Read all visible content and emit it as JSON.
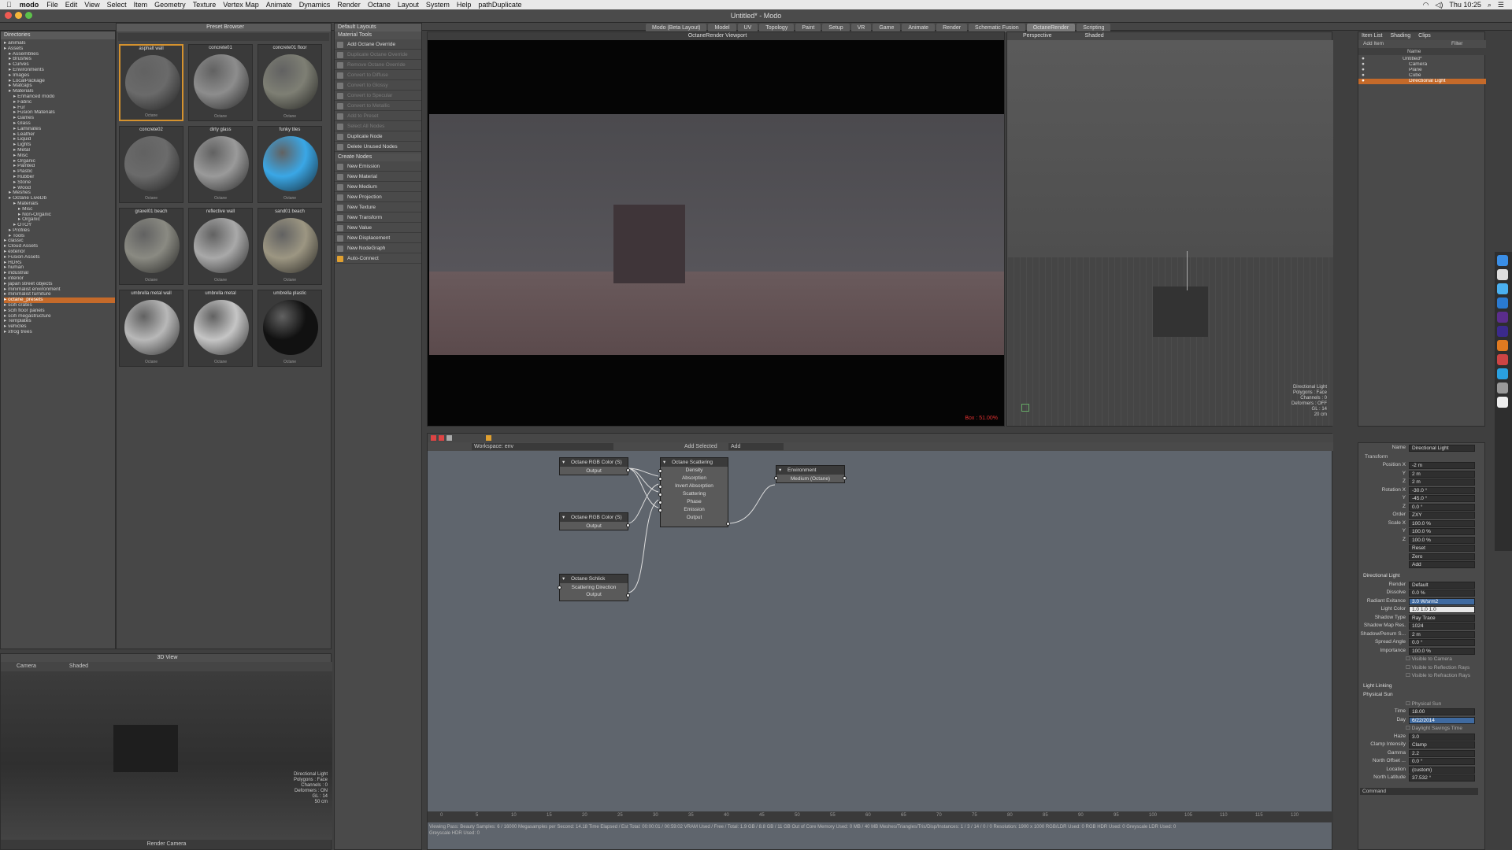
{
  "menubar": {
    "app_name": "modo",
    "items": [
      "File",
      "Edit",
      "View",
      "Select",
      "Item",
      "Geometry",
      "Texture",
      "Vertex Map",
      "Animate",
      "Dynamics",
      "Render",
      "Octane",
      "Layout",
      "System",
      "Help",
      "pathDuplicate"
    ],
    "clock": "Thu 10:25"
  },
  "window": {
    "title": "Untitled* - Modo",
    "layout_tabs": [
      "Modo (Beta Layout)",
      "Model",
      "UV",
      "Topology",
      "Paint",
      "Setup",
      "VR",
      "Game",
      "Animate",
      "Render",
      "Schematic Fusion",
      "OctaneRender",
      "Scripting"
    ],
    "active_tab": "OctaneRender"
  },
  "preset_browser": {
    "title": "Preset Browser",
    "tree_header": "Directories",
    "tree": [
      {
        "label": "animals",
        "indent": 0
      },
      {
        "label": "Assets",
        "indent": 0
      },
      {
        "label": "Assemblies",
        "indent": 1
      },
      {
        "label": "Brushes",
        "indent": 1
      },
      {
        "label": "Curves",
        "indent": 1
      },
      {
        "label": "Environments",
        "indent": 1
      },
      {
        "label": "Images",
        "indent": 1
      },
      {
        "label": "LocalPackage",
        "indent": 1
      },
      {
        "label": "Matcaps",
        "indent": 1
      },
      {
        "label": "Materials",
        "indent": 1
      },
      {
        "label": "Enhanced modo",
        "indent": 2
      },
      {
        "label": "Fabric",
        "indent": 2
      },
      {
        "label": "Fur",
        "indent": 2
      },
      {
        "label": "Fusion Materials",
        "indent": 2
      },
      {
        "label": "Games",
        "indent": 2
      },
      {
        "label": "Glass",
        "indent": 2
      },
      {
        "label": "Laminates",
        "indent": 2
      },
      {
        "label": "Leather",
        "indent": 2
      },
      {
        "label": "Liquid",
        "indent": 2
      },
      {
        "label": "Lights",
        "indent": 2
      },
      {
        "label": "Metal",
        "indent": 2
      },
      {
        "label": "Misc",
        "indent": 2
      },
      {
        "label": "Organic",
        "indent": 2
      },
      {
        "label": "Painted",
        "indent": 2
      },
      {
        "label": "Plastic",
        "indent": 2
      },
      {
        "label": "Rubber",
        "indent": 2
      },
      {
        "label": "Stone",
        "indent": 2
      },
      {
        "label": "Wood",
        "indent": 2
      },
      {
        "label": "Meshes",
        "indent": 1
      },
      {
        "label": "Octane LiveDb",
        "indent": 1
      },
      {
        "label": "Materials",
        "indent": 2
      },
      {
        "label": "Misc",
        "indent": 3
      },
      {
        "label": "Non-Organic",
        "indent": 3
      },
      {
        "label": "Organic",
        "indent": 3
      },
      {
        "label": "OTOY",
        "indent": 2
      },
      {
        "label": "Profiles",
        "indent": 1
      },
      {
        "label": "Tools",
        "indent": 1
      },
      {
        "label": "classic",
        "indent": 0
      },
      {
        "label": "Cloud Assets",
        "indent": 0
      },
      {
        "label": "exterior",
        "indent": 0
      },
      {
        "label": "Fusion Assets",
        "indent": 0
      },
      {
        "label": "HDRs",
        "indent": 0
      },
      {
        "label": "human",
        "indent": 0
      },
      {
        "label": "industrial",
        "indent": 0
      },
      {
        "label": "interior",
        "indent": 0
      },
      {
        "label": "japan street objects",
        "indent": 0
      },
      {
        "label": "minimalist environment",
        "indent": 0
      },
      {
        "label": "minimalist furniture",
        "indent": 0
      },
      {
        "label": "octane_presets",
        "indent": 0,
        "selected": true
      },
      {
        "label": "scifi crates",
        "indent": 0
      },
      {
        "label": "scifi floor panels",
        "indent": 0
      },
      {
        "label": "scifi megastructure",
        "indent": 0
      },
      {
        "label": "Templates",
        "indent": 0
      },
      {
        "label": "vehicles",
        "indent": 0
      },
      {
        "label": "xfrog trees",
        "indent": 0
      }
    ],
    "materials": [
      {
        "name": "asphalt wall",
        "color": "#6a6a6a",
        "selected": true
      },
      {
        "name": "concrete01",
        "color": "#8d8d8d"
      },
      {
        "name": "concrete01 floor",
        "color": "#7e7f74"
      },
      {
        "name": "concrete02",
        "color": "#6b6b6b"
      },
      {
        "name": "dirty glass",
        "color": "#9a9a9a"
      },
      {
        "name": "funky tiles",
        "color": "#3aa7e6"
      },
      {
        "name": "gravel01 beach",
        "color": "#8a8a82"
      },
      {
        "name": "reflective wall",
        "color": "#a9a9a9"
      },
      {
        "name": "sand01 beach",
        "color": "#9c9682"
      },
      {
        "name": "umbrella metal wall",
        "color": "#b8b8b8"
      },
      {
        "name": "umbrella metal",
        "color": "#c5c5c5"
      },
      {
        "name": "umbrella plastic",
        "color": "#111111"
      }
    ],
    "material_sub": "Octane"
  },
  "tools_panel": {
    "header": "Material Tools",
    "layout_dropdown": "Default Layouts",
    "items": [
      {
        "label": "Add Octane Override",
        "dim": false
      },
      {
        "label": "Duplicate Octane Override",
        "dim": true
      },
      {
        "label": "Remove Octane Override",
        "dim": true
      },
      {
        "label": "Convert to Diffuse",
        "dim": true
      },
      {
        "label": "Convert to Glossy",
        "dim": true
      },
      {
        "label": "Convert to Specular",
        "dim": true
      },
      {
        "label": "Convert to Metallic",
        "dim": true
      },
      {
        "label": "Add to Preset",
        "dim": true
      },
      {
        "label": "Select All Nodes",
        "dim": true
      },
      {
        "label": "Duplicate Node",
        "dim": false
      },
      {
        "label": "Delete Unused Nodes",
        "dim": false
      }
    ],
    "create_header": "Create Nodes",
    "create_items": [
      "New Emission",
      "New Material",
      "New Medium",
      "New Projection",
      "New Texture",
      "New Transform",
      "New Value",
      "New Displacement",
      "New NodeGraph"
    ],
    "auto_connect": "Auto-Connect"
  },
  "render_view": {
    "header": "OctaneRender Viewport",
    "status": "Box : 51.00%"
  },
  "viewport3d": {
    "label": "Perspective",
    "shading": "Shaded",
    "info": [
      "Directional Light",
      "Polygons : Face",
      "Channels : 0",
      "Deformers : OFF",
      "GL : 14",
      "20 cm"
    ]
  },
  "small_view": {
    "header": "3D View",
    "label": "Camera",
    "shading": "Shaded",
    "info": [
      "Directional Light",
      "Polygons : Face",
      "Channels : 0",
      "Deformers : ON",
      "GL : 14",
      "50 cm"
    ],
    "footer": "Render Camera"
  },
  "node_editor": {
    "schematic": "Workspace: env",
    "add_selected": "Add Selected",
    "add": "Add",
    "nodes": {
      "rgb1": {
        "title": "Octane RGB Color (S)",
        "out": "Output"
      },
      "rgb2": {
        "title": "Octane RGB Color (S)",
        "out": "Output"
      },
      "schlick": {
        "title": "Octane Schlick",
        "in": "Scattering Direction",
        "out": "Output"
      },
      "scattering": {
        "title": "Octane Scattering",
        "rows": [
          "Density",
          "Absorption",
          "Invert Absorption",
          "Scattering",
          "Phase",
          "Emission",
          "Output"
        ]
      },
      "env": {
        "title": "Environment",
        "row": "Medium (Octane)"
      }
    },
    "timeline_ticks": [
      "0",
      "5",
      "10",
      "15",
      "20",
      "25",
      "30",
      "35",
      "40",
      "45",
      "50",
      "55",
      "60",
      "65",
      "70",
      "75",
      "80",
      "85",
      "90",
      "95",
      "100",
      "105",
      "110",
      "115",
      "120"
    ],
    "status": "Viewing Pass: Beauty  Samples: 6 / 16000  Megasamples per Second: 14.18  Time Elapsed / Est Total: 00:00:01 / 00:59:02  VRAM Used / Free / Total: 1.9 GB / 8.8 GB / 11 GB  Out of Core Memory Used: 0 MB / 40 MB  Meshes/Triangles/Tris/Disp/Instances: 1 / 3 / 14 / 0 / 0  Resolution: 1900 x 1000  RGB/LDR Used: 0  RGB HDR Used: 0  Greyscale LDR Used: 0",
    "status2": "Greyscale HDR Used: 0"
  },
  "item_list": {
    "tabs": [
      "Item List",
      "Shading",
      "Clips"
    ],
    "add_item": "Add Item",
    "filter": "Filter",
    "name_col": "Name",
    "items": [
      {
        "label": "Untitled*",
        "indent": 0
      },
      {
        "label": "Camera",
        "indent": 1
      },
      {
        "label": "Plane",
        "indent": 1
      },
      {
        "label": "Cube",
        "indent": 1
      },
      {
        "label": "Directional Light",
        "indent": 1,
        "selected": true
      }
    ]
  },
  "properties": {
    "name_label": "Name",
    "name_value": "Directional Light",
    "transform_header": "Transform",
    "rows": [
      {
        "k": "Position X",
        "v": "-2 m"
      },
      {
        "k": "Y",
        "v": "2 m"
      },
      {
        "k": "Z",
        "v": "2 m"
      },
      {
        "k": "Rotation X",
        "v": "-30.0 °"
      },
      {
        "k": "Y",
        "v": "-45.0 °"
      },
      {
        "k": "Z",
        "v": "0.0 °"
      },
      {
        "k": "Order",
        "v": "ZXY"
      },
      {
        "k": "Scale X",
        "v": "100.0 %"
      },
      {
        "k": "Y",
        "v": "100.0 %"
      },
      {
        "k": "Z",
        "v": "100.0 %"
      },
      {
        "k": "",
        "v": "Reset"
      },
      {
        "k": "",
        "v": "Zero"
      },
      {
        "k": "",
        "v": "Add"
      }
    ],
    "light_header": "Directional Light",
    "light_rows": [
      {
        "k": "Render",
        "v": "Default"
      },
      {
        "k": "Dissolve",
        "v": "0.0 %"
      },
      {
        "k": "Radiant Exitance",
        "v": "3.0 W/srm2"
      },
      {
        "k": "Light Color",
        "v": "1.0   1.0   1.0"
      },
      {
        "k": "Shadow Type",
        "v": "Ray Trace"
      },
      {
        "k": "Shadow Map Res.",
        "v": "1024"
      },
      {
        "k": "Shadow/Penum S...",
        "v": "2 m"
      },
      {
        "k": "Spread Angle",
        "v": "0.0 °"
      },
      {
        "k": "Importance",
        "v": "100.0 %"
      }
    ],
    "checks": [
      "Visible to Camera",
      "Visible to Reflection Rays",
      "Visible to Refraction Rays"
    ],
    "linking": "Light Linking",
    "sun_header": "Physical Sun",
    "sun_check": "Physical Sun",
    "sun_rows": [
      {
        "k": "Time",
        "v": "18.00"
      },
      {
        "k": "Day",
        "v": "6/22/2014"
      }
    ],
    "dst": "Daylight Savings Time",
    "sun_rows2": [
      {
        "k": "Haze",
        "v": "3.0"
      },
      {
        "k": "Clamp Intensity",
        "v": "Clamp"
      },
      {
        "k": "Gamma",
        "v": "2.2"
      },
      {
        "k": "North Offset ...",
        "v": "0.0 °"
      },
      {
        "k": "Location",
        "v": "(custom)"
      },
      {
        "k": "North Latitude",
        "v": "37.532 °"
      }
    ],
    "command": "Command"
  }
}
